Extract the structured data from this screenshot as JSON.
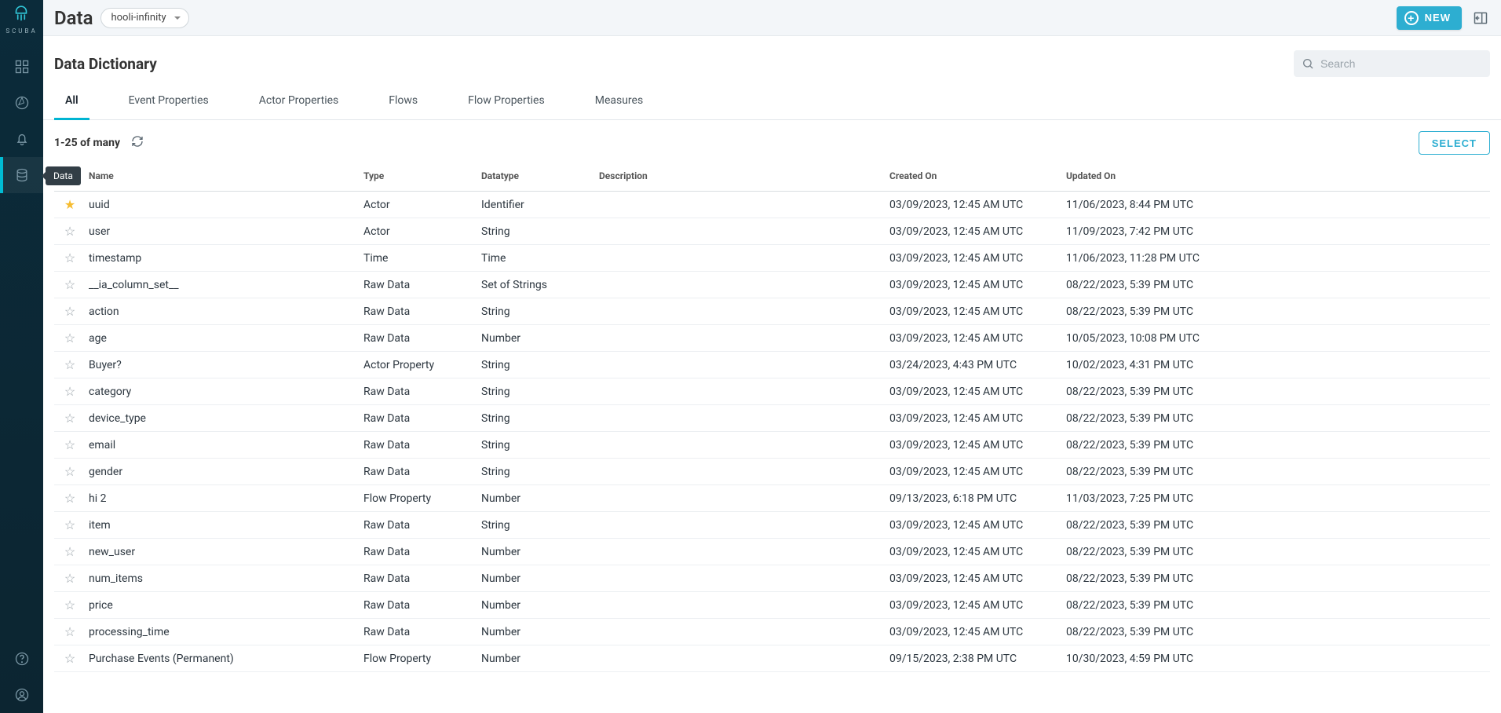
{
  "brand": {
    "name": "SCUBA"
  },
  "sidebar": {
    "tooltip": "Data"
  },
  "topbar": {
    "title": "Data",
    "dataset": "hooli-infinity",
    "new_label": "NEW"
  },
  "subhead": {
    "title": "Data Dictionary"
  },
  "search": {
    "placeholder": "Search"
  },
  "tabs": [
    {
      "label": "All",
      "active": true
    },
    {
      "label": "Event Properties"
    },
    {
      "label": "Actor Properties"
    },
    {
      "label": "Flows"
    },
    {
      "label": "Flow Properties"
    },
    {
      "label": "Measures"
    }
  ],
  "toolbar": {
    "count_label": "1-25 of many",
    "select_label": "SELECT"
  },
  "columns": {
    "name": "Name",
    "type": "Type",
    "datatype": "Datatype",
    "description": "Description",
    "created": "Created On",
    "updated": "Updated On"
  },
  "rows": [
    {
      "fav": true,
      "name": "uuid",
      "type": "Actor",
      "datatype": "Identifier",
      "created": "03/09/2023, 12:45 AM UTC",
      "updated": "11/06/2023, 8:44 PM UTC"
    },
    {
      "fav": false,
      "name": "user",
      "type": "Actor",
      "datatype": "String",
      "created": "03/09/2023, 12:45 AM UTC",
      "updated": "11/09/2023, 7:42 PM UTC"
    },
    {
      "fav": false,
      "name": "timestamp",
      "type": "Time",
      "datatype": "Time",
      "created": "03/09/2023, 12:45 AM UTC",
      "updated": "11/06/2023, 11:28 PM UTC"
    },
    {
      "fav": false,
      "name": "__ia_column_set__",
      "type": "Raw Data",
      "datatype": "Set of Strings",
      "created": "03/09/2023, 12:45 AM UTC",
      "updated": "08/22/2023, 5:39 PM UTC"
    },
    {
      "fav": false,
      "name": "action",
      "type": "Raw Data",
      "datatype": "String",
      "created": "03/09/2023, 12:45 AM UTC",
      "updated": "08/22/2023, 5:39 PM UTC"
    },
    {
      "fav": false,
      "name": "age",
      "type": "Raw Data",
      "datatype": "Number",
      "created": "03/09/2023, 12:45 AM UTC",
      "updated": "10/05/2023, 10:08 PM UTC"
    },
    {
      "fav": false,
      "name": "Buyer?",
      "type": "Actor Property",
      "datatype": "String",
      "created": "03/24/2023, 4:43 PM UTC",
      "updated": "10/02/2023, 4:31 PM UTC"
    },
    {
      "fav": false,
      "name": "category",
      "type": "Raw Data",
      "datatype": "String",
      "created": "03/09/2023, 12:45 AM UTC",
      "updated": "08/22/2023, 5:39 PM UTC"
    },
    {
      "fav": false,
      "name": "device_type",
      "type": "Raw Data",
      "datatype": "String",
      "created": "03/09/2023, 12:45 AM UTC",
      "updated": "08/22/2023, 5:39 PM UTC"
    },
    {
      "fav": false,
      "name": "email",
      "type": "Raw Data",
      "datatype": "String",
      "created": "03/09/2023, 12:45 AM UTC",
      "updated": "08/22/2023, 5:39 PM UTC"
    },
    {
      "fav": false,
      "name": "gender",
      "type": "Raw Data",
      "datatype": "String",
      "created": "03/09/2023, 12:45 AM UTC",
      "updated": "08/22/2023, 5:39 PM UTC"
    },
    {
      "fav": false,
      "name": "hi 2",
      "type": "Flow Property",
      "datatype": "Number",
      "created": "09/13/2023, 6:18 PM UTC",
      "updated": "11/03/2023, 7:25 PM UTC"
    },
    {
      "fav": false,
      "name": "item",
      "type": "Raw Data",
      "datatype": "String",
      "created": "03/09/2023, 12:45 AM UTC",
      "updated": "08/22/2023, 5:39 PM UTC"
    },
    {
      "fav": false,
      "name": "new_user",
      "type": "Raw Data",
      "datatype": "Number",
      "created": "03/09/2023, 12:45 AM UTC",
      "updated": "08/22/2023, 5:39 PM UTC"
    },
    {
      "fav": false,
      "name": "num_items",
      "type": "Raw Data",
      "datatype": "Number",
      "created": "03/09/2023, 12:45 AM UTC",
      "updated": "08/22/2023, 5:39 PM UTC"
    },
    {
      "fav": false,
      "name": "price",
      "type": "Raw Data",
      "datatype": "Number",
      "created": "03/09/2023, 12:45 AM UTC",
      "updated": "08/22/2023, 5:39 PM UTC"
    },
    {
      "fav": false,
      "name": "processing_time",
      "type": "Raw Data",
      "datatype": "Number",
      "created": "03/09/2023, 12:45 AM UTC",
      "updated": "08/22/2023, 5:39 PM UTC"
    },
    {
      "fav": false,
      "name": "Purchase Events (Permanent)",
      "type": "Flow Property",
      "datatype": "Number",
      "created": "09/15/2023, 2:38 PM UTC",
      "updated": "10/30/2023, 4:59 PM UTC"
    }
  ]
}
